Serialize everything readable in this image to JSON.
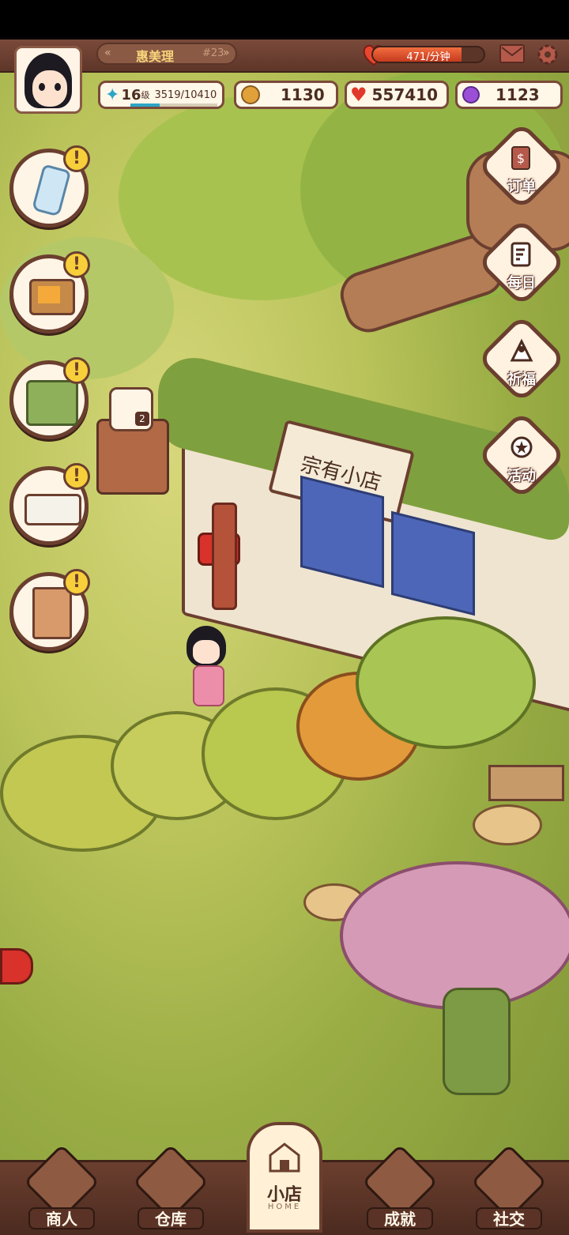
{
  "player": {
    "name": "惠美理",
    "rank": "#23",
    "level_value": "16",
    "level_unit": "级",
    "exp": "3519/10410",
    "level_progress": 0.338
  },
  "energy": {
    "rate": "471/分钟",
    "fill": 0.8
  },
  "currencies": {
    "coins": "1130",
    "hearts": "557410",
    "gems": "1123"
  },
  "left_buttons": [
    {
      "id": "milk",
      "alert": "!"
    },
    {
      "id": "tv",
      "alert": "!"
    },
    {
      "id": "stall",
      "alert": "!"
    },
    {
      "id": "bed",
      "alert": "!"
    },
    {
      "id": "sign",
      "alert": "!"
    }
  ],
  "right_buttons": [
    {
      "label": "订单",
      "icon": "order-icon"
    },
    {
      "label": "每日",
      "icon": "daily-icon"
    },
    {
      "label": "祈福",
      "icon": "prayer-icon"
    },
    {
      "label": "活动",
      "icon": "event-icon"
    }
  ],
  "scene": {
    "shop_sign": "宗有小店",
    "pot_badge": "2"
  },
  "bottom_nav": [
    {
      "label": "商人",
      "icon": "merchant-icon"
    },
    {
      "label": "仓库",
      "icon": "warehouse-icon"
    },
    {
      "label": "小店",
      "sub": "HOME",
      "icon": "shop-home-icon"
    },
    {
      "label": "成就",
      "icon": "achievement-icon"
    },
    {
      "label": "社交",
      "icon": "social-icon"
    }
  ],
  "colors": {
    "hud_brown": "#7a4a3a",
    "alert_yellow": "#f7cf3a",
    "energy_red": "#e8472f",
    "gem_purple": "#9b4fd6",
    "coin_gold": "#e0a03a"
  }
}
